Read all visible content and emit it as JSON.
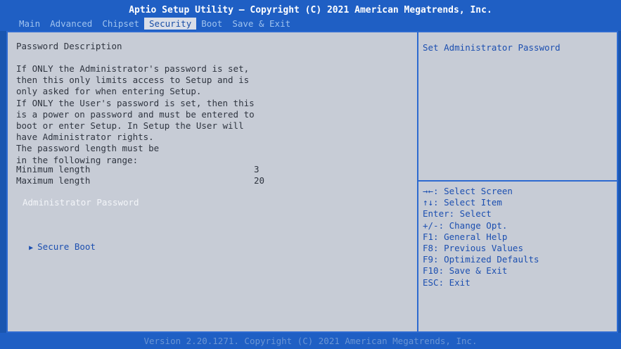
{
  "header": {
    "title": "Aptio Setup Utility – Copyright (C) 2021 American Megatrends, Inc.",
    "tabs": [
      {
        "label": "Main"
      },
      {
        "label": "Advanced"
      },
      {
        "label": "Chipset"
      },
      {
        "label": "Security",
        "active": true
      },
      {
        "label": "Boot"
      },
      {
        "label": "Save & Exit"
      }
    ]
  },
  "main": {
    "description_title": "Password Description",
    "description_lines": [
      "If ONLY the Administrator's password is set,",
      "then this only limits access to Setup and is",
      "only asked for when entering Setup.",
      "If ONLY the User's password is set, then this",
      "is a power on password and must be entered to",
      "boot or enter Setup. In Setup the User will",
      "have Administrator rights.",
      "The password length must be",
      "in the following range:"
    ],
    "min_length_label": "Minimum length",
    "min_length_value": "3",
    "max_length_label": "Maximum length",
    "max_length_value": "20",
    "admin_password_label": "Administrator Password",
    "secure_boot_label": "Secure Boot"
  },
  "help": {
    "title": "Set Administrator Password",
    "keys": [
      "→←: Select Screen",
      "↑↓: Select Item",
      "Enter: Select",
      "+/-: Change Opt.",
      "F1: General Help",
      "F8: Previous Values",
      "F9: Optimized Defaults",
      "F10: Save & Exit",
      "ESC: Exit"
    ]
  },
  "footer": {
    "version": "Version 2.20.1271. Copyright (C) 2021 American Megatrends, Inc."
  },
  "colors": {
    "background": "#1a56b0",
    "panel": "#c7ccd6",
    "active_tab_bg": "#d9dee8",
    "highlight_text": "#1c4fb0",
    "selected_item_text": "#f3f5f9"
  },
  "icons": {
    "submenu_arrow": "triangle-right-icon"
  }
}
